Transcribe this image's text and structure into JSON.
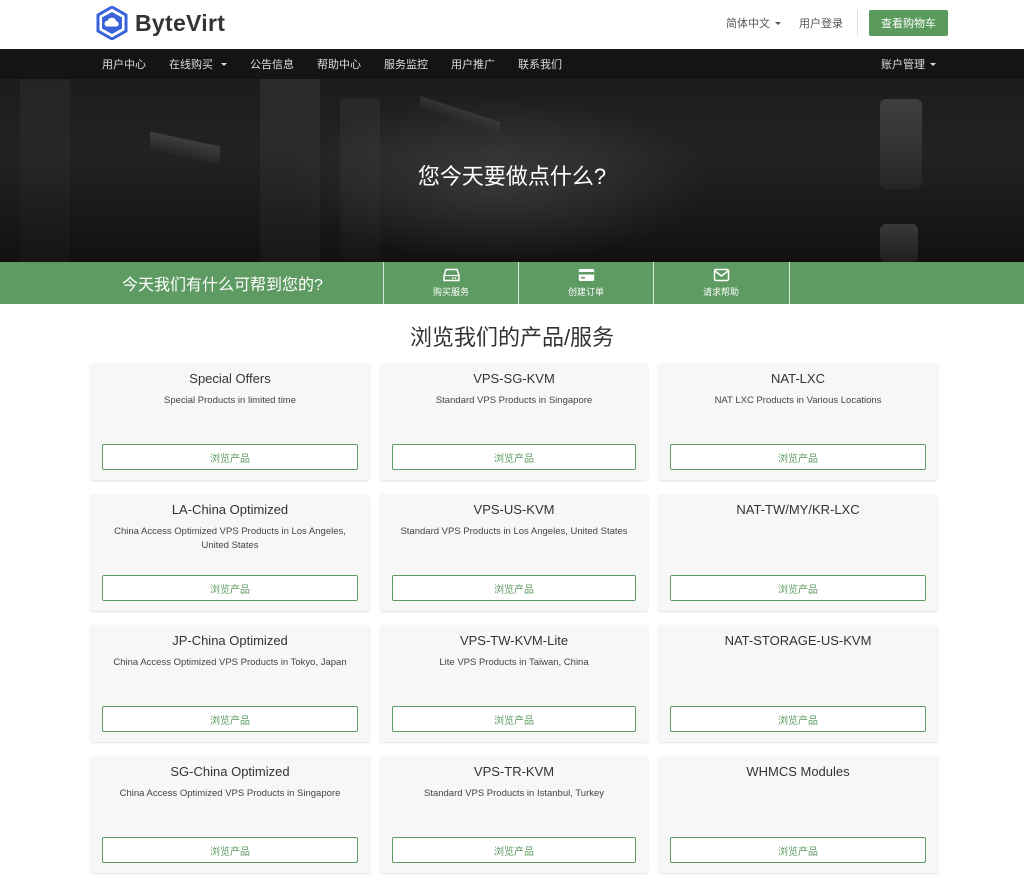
{
  "brand": {
    "name": "ByteVirt",
    "accent": "#5e9b62"
  },
  "top_links": {
    "language": "简体中文",
    "login": "用户登录",
    "cart": "查看购物车"
  },
  "nav": {
    "items": [
      {
        "label": "用户中心",
        "dropdown": false
      },
      {
        "label": "在线购买",
        "dropdown": true
      },
      {
        "label": "公告信息",
        "dropdown": false
      },
      {
        "label": "帮助中心",
        "dropdown": false
      },
      {
        "label": "服务监控",
        "dropdown": false
      },
      {
        "label": "用户推广",
        "dropdown": false
      },
      {
        "label": "联系我们",
        "dropdown": false
      }
    ],
    "account": "账户管理"
  },
  "hero": {
    "title": "您今天要做点什么?"
  },
  "helpbar": {
    "text": "今天我们有什么可帮到您的?",
    "buttons": [
      {
        "label": "购买服务",
        "icon": "server-icon"
      },
      {
        "label": "创建订单",
        "icon": "credit-card-icon"
      },
      {
        "label": "请求帮助",
        "icon": "envelope-icon"
      }
    ]
  },
  "section": {
    "title": "浏览我们的产品/服务"
  },
  "products": [
    {
      "title": "Special Offers",
      "desc": "Special Products in limited time",
      "button": "浏览产品"
    },
    {
      "title": "VPS-SG-KVM",
      "desc": "Standard VPS Products in Singapore",
      "button": "浏览产品"
    },
    {
      "title": "NAT-LXC",
      "desc": "NAT LXC Products in Various Locations",
      "button": "浏览产品"
    },
    {
      "title": "LA-China Optimized",
      "desc": "China Access Optimized VPS Products in Los Angeles, United States",
      "button": "浏览产品"
    },
    {
      "title": "VPS-US-KVM",
      "desc": "Standard VPS Products in Los Angeles, United States",
      "button": "浏览产品"
    },
    {
      "title": "NAT-TW/MY/KR-LXC",
      "desc": "",
      "button": "浏览产品"
    },
    {
      "title": "JP-China Optimized",
      "desc": "China Access Optimized VPS Products in Tokyo, Japan",
      "button": "浏览产品"
    },
    {
      "title": "VPS-TW-KVM-Lite",
      "desc": "Lite VPS Products in Taiwan, China",
      "button": "浏览产品"
    },
    {
      "title": "NAT-STORAGE-US-KVM",
      "desc": "",
      "button": "浏览产品"
    },
    {
      "title": "SG-China Optimized",
      "desc": "China Access Optimized VPS Products in Singapore",
      "button": "浏览产品"
    },
    {
      "title": "VPS-TR-KVM",
      "desc": "Standard VPS Products in Istanbul, Turkey",
      "button": "浏览产品"
    },
    {
      "title": "WHMCS Modules",
      "desc": "",
      "button": "浏览产品"
    }
  ]
}
